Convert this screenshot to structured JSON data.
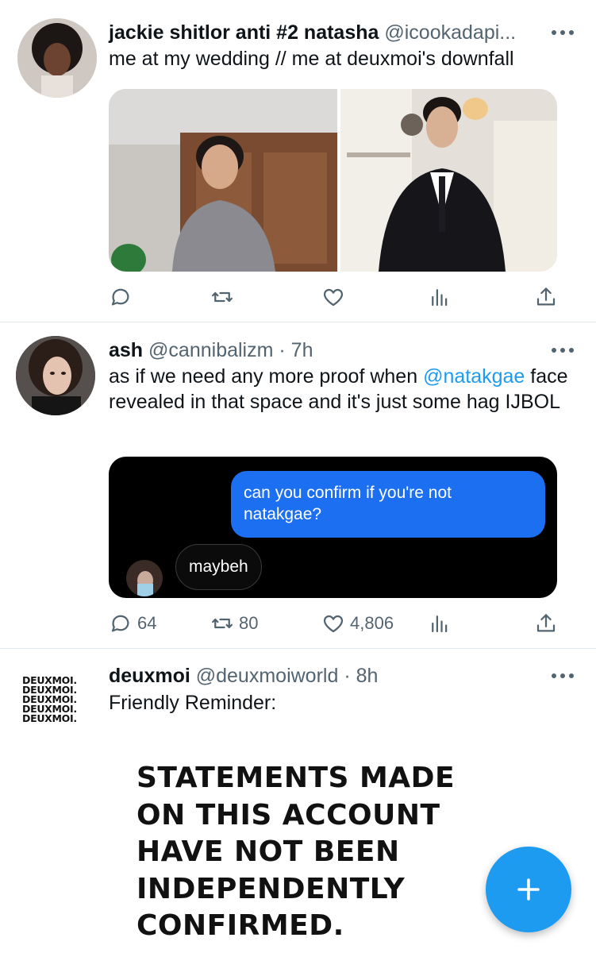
{
  "tweets": [
    {
      "name": "jackie shitlor anti #2 natasha",
      "handle": "@icookadapi...",
      "time": "",
      "text": "me at my wedding // me at deuxmoi's downfall",
      "stats": {
        "replies": "",
        "retweets": "",
        "likes": ""
      }
    },
    {
      "name": "ash",
      "handle": "@cannibalizm",
      "time": "· 7h",
      "text_before": "as if we need any more proof when ",
      "mention": "@natakgae",
      "text_after": " face revealed in that space and it's just some hag IJBOL",
      "chat": {
        "sent_message": "can you confirm if you're not natakgae?",
        "reply_message": "maybeh"
      },
      "stats": {
        "replies": "64",
        "retweets": "80",
        "likes": "4,806"
      }
    },
    {
      "name": "deuxmoi",
      "handle": "@deuxmoiworld",
      "time": "· 8h",
      "text": "Friendly Reminder:",
      "avatar_lines": [
        "DEUXMOI.",
        "DEUXMOI.",
        "DEUXMOI.",
        "DEUXMOI.",
        "DEUXMOI."
      ],
      "statement_lines": [
        "STATEMENTS MADE",
        "ON THIS ACCOUNT",
        "HAVE NOT BEEN",
        "INDEPENDENTLY",
        "CONFIRMED."
      ]
    }
  ],
  "fab": {
    "icon": "plus-icon"
  },
  "colors": {
    "accent": "#1d9bf0",
    "muted": "#536471",
    "chat_bubble": "#1d6ff2"
  }
}
